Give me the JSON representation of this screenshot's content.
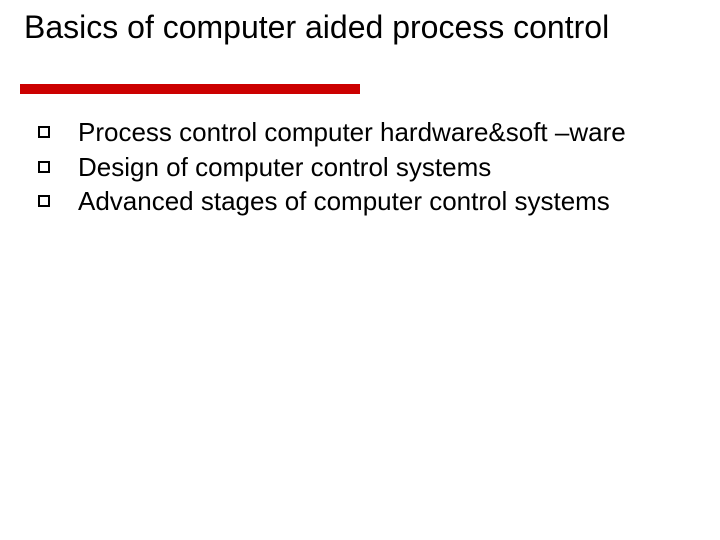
{
  "slide": {
    "title": "Basics of computer aided process control",
    "bullets": [
      "Process control computer hardware&soft –ware",
      "Design of computer control systems",
      "Advanced stages of computer control systems"
    ]
  }
}
